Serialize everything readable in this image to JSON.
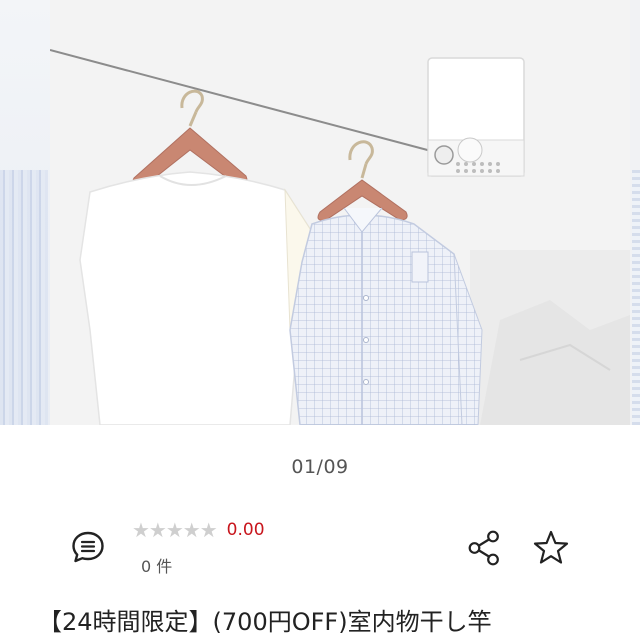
{
  "carousel": {
    "current_index": "01/09"
  },
  "product": {
    "stars": "★★★★★",
    "rating_value": "0.00",
    "review_count": "0 件",
    "title": "【24時間限定】(700円OFF)室内物干し竿"
  },
  "colors": {
    "rating_red": "#c8161d",
    "star_grey": "#cfcfcf",
    "icon_dark": "#222222"
  },
  "icons": {
    "comment": "speech-bubble-icon",
    "share": "share-icon",
    "favorite": "star-outline-icon"
  }
}
